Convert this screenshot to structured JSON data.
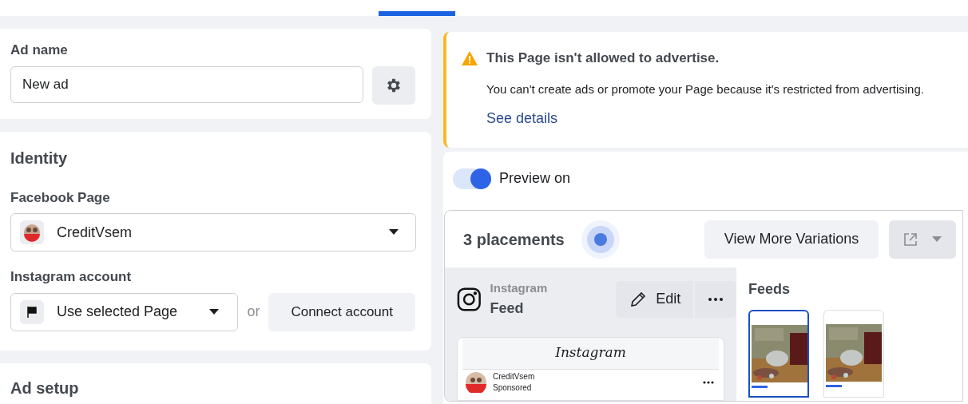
{
  "ad_name": {
    "label": "Ad name",
    "value": "New ad"
  },
  "identity": {
    "title": "Identity",
    "facebook_page": {
      "label": "Facebook Page",
      "value": "CreditVsem"
    },
    "instagram_account": {
      "label": "Instagram account",
      "value": "Use selected Page",
      "separator": "or",
      "connect_button": "Connect account"
    }
  },
  "ad_setup": {
    "title": "Ad setup"
  },
  "alert": {
    "title": "This Page isn't allowed to advertise.",
    "message": "You can't create ads or promote your Page because it's restricted from advertising.",
    "link": "See details"
  },
  "preview_toggle": {
    "label": "Preview on",
    "on": true
  },
  "placements": {
    "title": "3 placements",
    "view_more_button": "View More Variations",
    "placement": {
      "platform": "Instagram",
      "position": "Feed",
      "edit_button": "Edit"
    },
    "mock_post": {
      "app_name": "Instagram",
      "account": "CreditVsem",
      "sponsored": "Sponsored"
    },
    "feeds": {
      "title": "Feeds",
      "thumbnails": [
        {
          "selected": true
        },
        {
          "selected": false
        }
      ]
    }
  }
}
